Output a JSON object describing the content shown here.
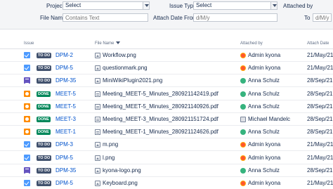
{
  "filters": {
    "project_label": "Project",
    "project_value": "Select",
    "issue_type_label": "Issue Type",
    "issue_type_value": "Select",
    "attached_by_label": "Attached by",
    "file_name_label": "File Name",
    "file_name_placeholder": "Contains Text",
    "attach_date_from_label": "Attach Date From",
    "attach_date_from_placeholder": "d/M/y",
    "to_label": "To",
    "to_placeholder": "d/M/y"
  },
  "table": {
    "headers": {
      "issue": "Issue",
      "file_name": "File Name",
      "attached_by": "Attached by",
      "attach_date": "Attach Date"
    },
    "rows": [
      {
        "type": "task",
        "status": "TO DO",
        "key": "DPM-2",
        "file_icon": "image-icon",
        "file": "Workflow.png",
        "user_avatar": "admin",
        "user": "Admin kyona",
        "date": "21/May/21"
      },
      {
        "type": "task",
        "status": "TO DO",
        "key": "DPM-5",
        "file_icon": "image-icon",
        "file": "questionmark.png",
        "user_avatar": "admin",
        "user": "Admin kyona",
        "date": "21/May/21"
      },
      {
        "type": "story",
        "status": "TO DO",
        "key": "DPM-35",
        "file_icon": "image-icon",
        "file": "MiniWikiPlugin2021.png",
        "user_avatar": "anna",
        "user": "Anna Schulz",
        "date": "28/Sep/21"
      },
      {
        "type": "meeting",
        "status": "DONE",
        "key": "MEET-5",
        "file_icon": "pdf-icon",
        "file": "Meeting_MEET-5_Minutes_280921142419.pdf",
        "user_avatar": "anna",
        "user": "Anna Schulz",
        "date": "28/Sep/21"
      },
      {
        "type": "meeting",
        "status": "DONE",
        "key": "MEET-5",
        "file_icon": "pdf-icon",
        "file": "Meeting_MEET-5_Minutes_280921140926.pdf",
        "user_avatar": "anna",
        "user": "Anna Schulz",
        "date": "28/Sep/21"
      },
      {
        "type": "meeting",
        "status": "DONE",
        "key": "MEET-3",
        "file_icon": "pdf-icon",
        "file": "Meeting_MEET-3_Minutes_280921151724.pdf",
        "user_avatar": "michael",
        "user": "Michael Mandelc",
        "date": "28/Sep/21"
      },
      {
        "type": "meeting",
        "status": "DONE",
        "key": "MEET-1",
        "file_icon": "pdf-icon",
        "file": "Meeting_MEET-1_Minutes_280921124626.pdf",
        "user_avatar": "anna",
        "user": "Anna Schulz",
        "date": "28/Sep/21"
      },
      {
        "type": "task",
        "status": "TO DO",
        "key": "DPM-3",
        "file_icon": "image-icon",
        "file": "m.png",
        "user_avatar": "admin",
        "user": "Admin kyona",
        "date": "21/May/21"
      },
      {
        "type": "task",
        "status": "TO DO",
        "key": "DPM-5",
        "file_icon": "image-icon",
        "file": "l.png",
        "user_avatar": "admin",
        "user": "Admin kyona",
        "date": "21/May/21"
      },
      {
        "type": "story",
        "status": "TO DO",
        "key": "DPM-35",
        "file_icon": "image-icon",
        "file": "kyona-logo.png",
        "user_avatar": "anna",
        "user": "Anna Schulz",
        "date": "28/Sep/21"
      },
      {
        "type": "task",
        "status": "TO DO",
        "key": "DPM-5",
        "file_icon": "image-icon",
        "file": "Keyboard.png",
        "user_avatar": "admin",
        "user": "Admin kyona",
        "date": "21/May/21"
      }
    ]
  },
  "colors": {
    "todo_badge": "#42526e",
    "done_badge": "#00875a",
    "link": "#0052cc",
    "task_icon": "#4c9aff",
    "story_icon": "#6554c0",
    "meeting_icon": "#ff8b00"
  }
}
